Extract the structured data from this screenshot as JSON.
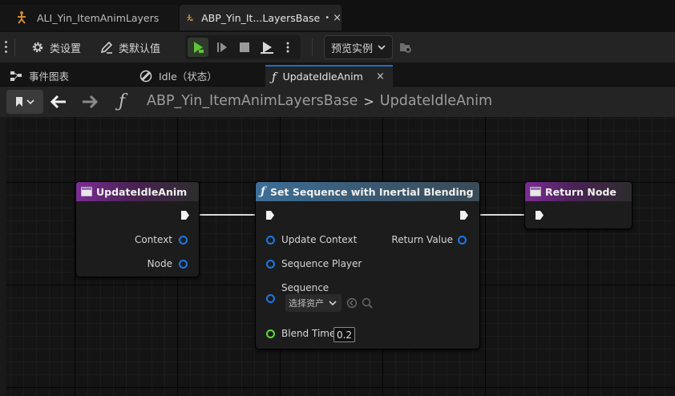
{
  "document_tabs": [
    {
      "label": "ALI_Yin_ItemAnimLayers",
      "active": false
    },
    {
      "label": "ABP_Yin_It...LayersBase",
      "active": true,
      "dirty_marker": "•",
      "close": "×"
    }
  ],
  "toolbar": {
    "class_settings": "类设置",
    "class_defaults": "类默认值",
    "preview_instance": "预览实例"
  },
  "graph_tabs": [
    {
      "label": "事件图表",
      "icon": "event-graph-icon"
    },
    {
      "label": "Idle（状态）",
      "icon": "state-icon"
    },
    {
      "label": "UpdateIdleAnim",
      "icon": "function-icon",
      "active": true,
      "close": "×"
    }
  ],
  "breadcrumb": {
    "fx": "ƒ",
    "items": [
      "ABP_Yin_ItemAnimLayersBase",
      "UpdateIdleAnim"
    ],
    "separator": ">"
  },
  "nodes": {
    "entry": {
      "title": "UpdateIdleAnim",
      "outputs": [
        "Context",
        "Node"
      ]
    },
    "set_sequence": {
      "title": "Set Sequence with Inertial Blending",
      "inputs": [
        "Update Context",
        "Sequence Player",
        "Sequence",
        "Blend Time"
      ],
      "output": "Return Value",
      "asset_select": "选择资产",
      "blend_time_value": "0.2"
    },
    "return": {
      "title": "Return Node"
    }
  },
  "colors": {
    "pin_struct": "#1b78e8",
    "pin_float": "#5bdc3c",
    "header_function": "#3d6e96",
    "header_entry": "#7b2d95",
    "tab_accent": "#1d6fc9"
  }
}
